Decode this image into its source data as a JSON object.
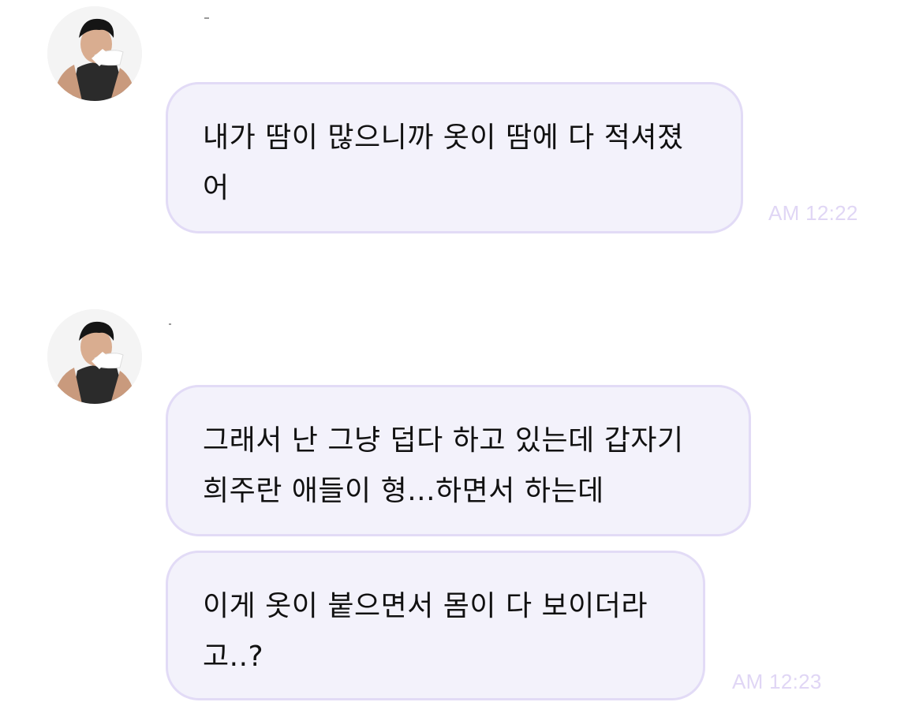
{
  "chat": {
    "messages": [
      {
        "text": "내가 땀이 많으니까 옷이 땀에 다 적셔졌어",
        "time": "AM 12:22"
      },
      {
        "text": "그래서 난 그냥 덥다 하고 있는데 갑자기 희주란 애들이 형...하면서 하는데",
        "time": ""
      },
      {
        "text": "이게 옷이 붙으면서 몸이 다 보이더라고..?",
        "time": "AM 12:23"
      }
    ]
  },
  "colors": {
    "bubble_background": "#f3f2fb",
    "bubble_border": "#e2dbf6",
    "timestamp": "#e0d6f5",
    "text": "#111111"
  },
  "icons": {
    "avatar": "profile-photo-avatar"
  }
}
